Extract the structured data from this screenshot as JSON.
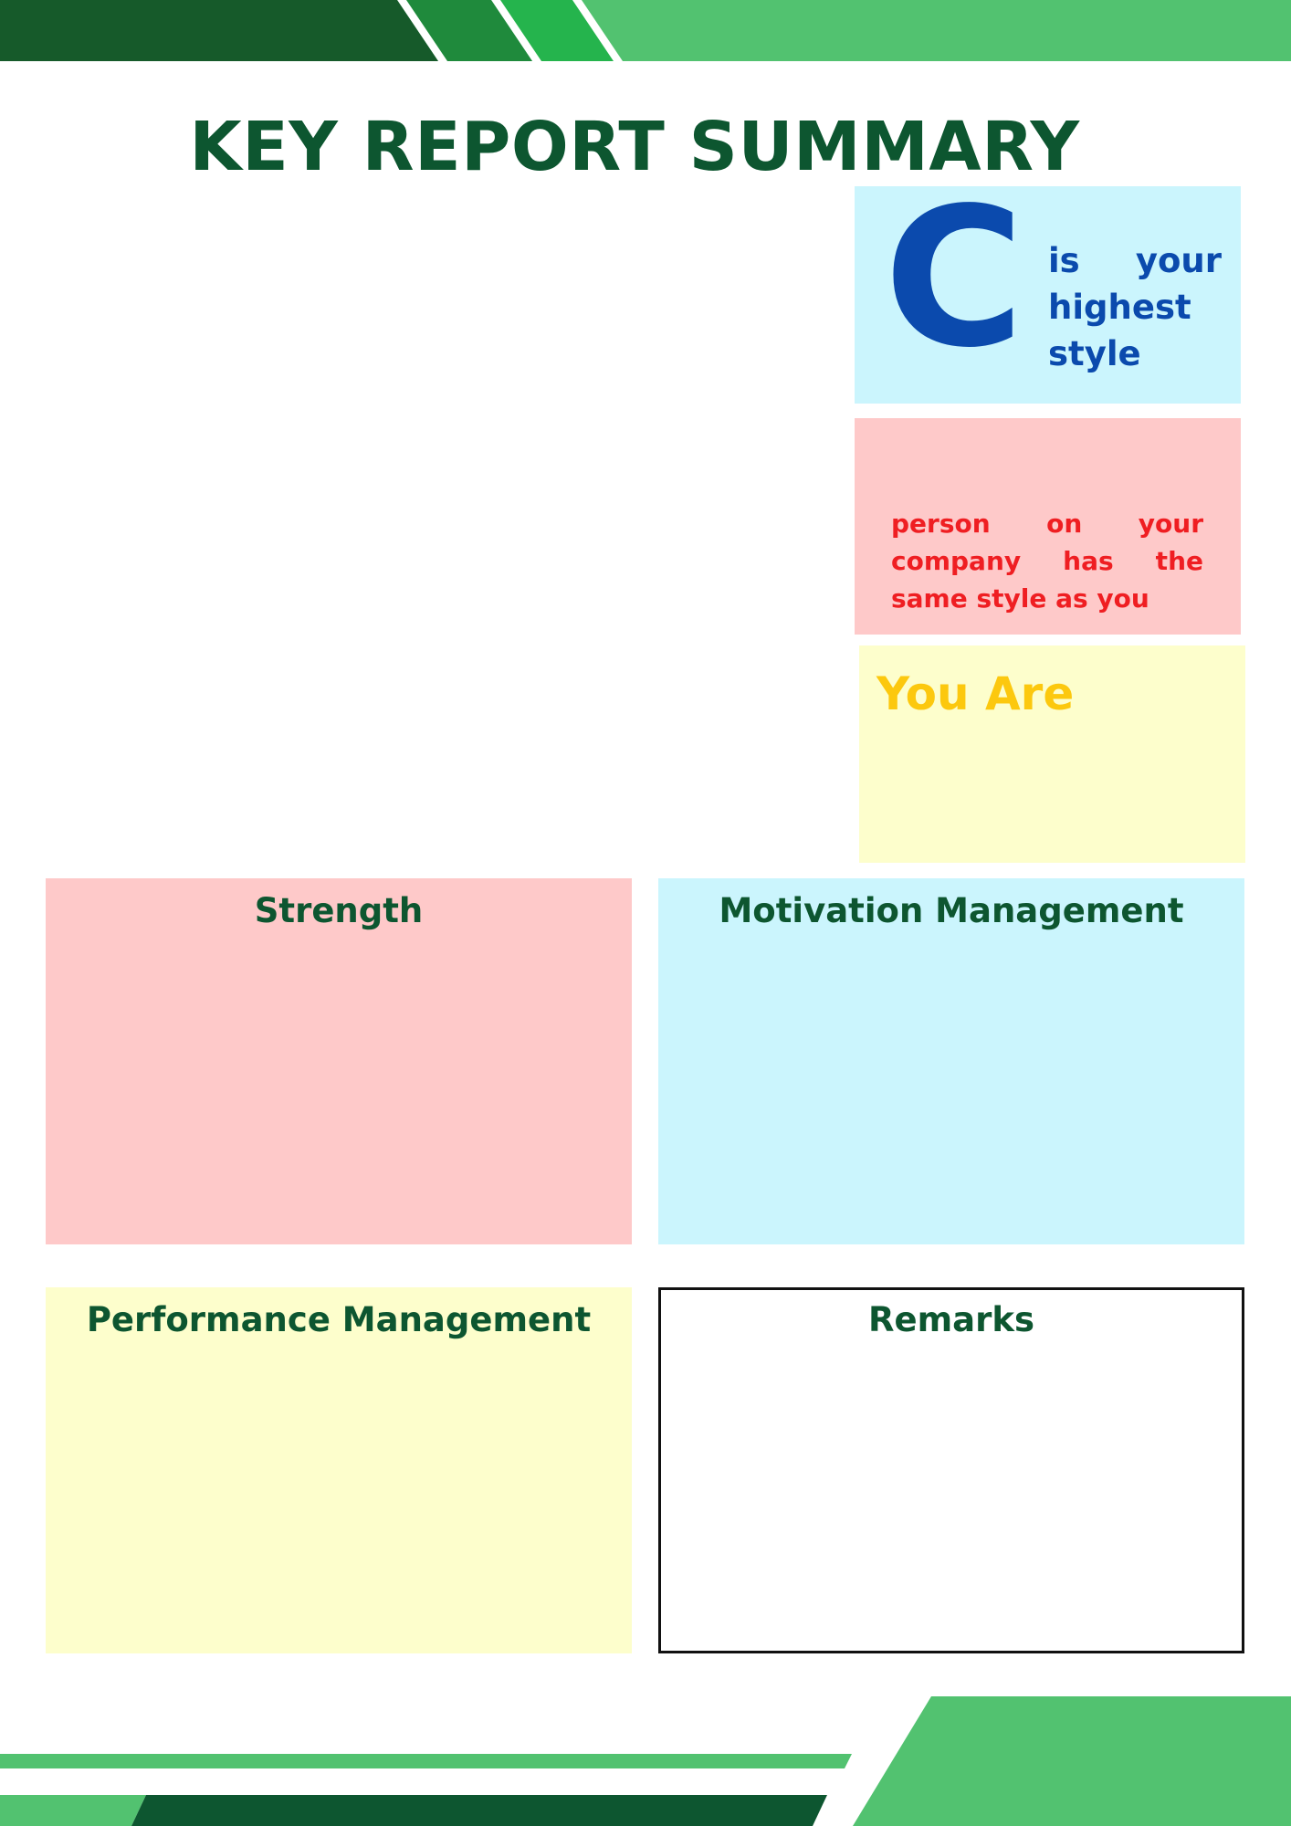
{
  "header": {
    "title": "KEY REPORT SUMMARY"
  },
  "style_card": {
    "letter": "C",
    "text": "is your highest style"
  },
  "person_card": {
    "text": "person on your company has the same style as you"
  },
  "you_are_card": {
    "text": "You Are"
  },
  "sections": {
    "strength": "Strength",
    "motivation": "Motivation Management",
    "performance": "Performance Management",
    "remarks": "Remarks"
  },
  "colors": {
    "dark_green": "#165a2a",
    "mid_green": "#1f8a3c",
    "bright_green": "#25b44d",
    "light_green": "#52c270",
    "title_green": "#0d5630",
    "blue": "#0b4aad",
    "red": "#ef1e22",
    "yellow": "#fcc80e",
    "pink_bg": "#fec9c9",
    "cyan_bg": "#cbf5fd",
    "yellow_bg": "#fdfecc"
  }
}
